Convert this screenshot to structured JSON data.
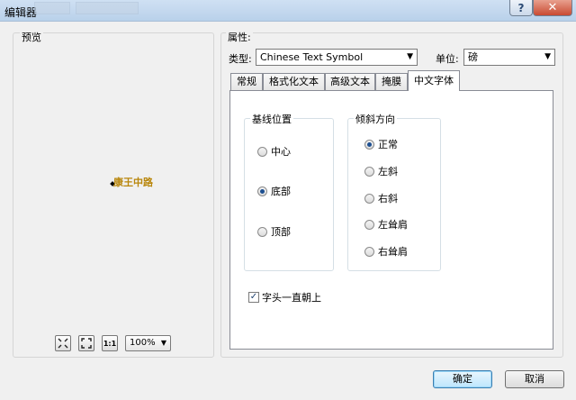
{
  "window": {
    "title": "编辑器",
    "help_label": "?",
    "close_label": "✕"
  },
  "preview": {
    "group_label": "预览",
    "sample_text": "康王中路",
    "zoom_value": "100%",
    "tool_icons": [
      "zoom-in-icon",
      "zoom-extent-icon",
      "actual-size-icon"
    ],
    "actual_size_label": "1:1"
  },
  "properties": {
    "group_label": "属性:",
    "type_label": "类型:",
    "type_value": "Chinese Text Symbol",
    "unit_label": "单位:",
    "unit_value": "磅"
  },
  "tabs": [
    {
      "label": "常规"
    },
    {
      "label": "格式化文本"
    },
    {
      "label": "高级文本"
    },
    {
      "label": "掩膜"
    },
    {
      "label": "中文字体"
    }
  ],
  "active_tab": "中文字体",
  "baseline": {
    "title": "基线位置",
    "options": [
      {
        "label": "中心",
        "checked": false
      },
      {
        "label": "底部",
        "checked": true
      },
      {
        "label": "顶部",
        "checked": false
      }
    ]
  },
  "slant": {
    "title": "倾斜方向",
    "options": [
      {
        "label": "正常",
        "checked": true
      },
      {
        "label": "左斜",
        "checked": false
      },
      {
        "label": "右斜",
        "checked": false
      },
      {
        "label": "左耸肩",
        "checked": false
      },
      {
        "label": "右耸肩",
        "checked": false
      }
    ]
  },
  "head_up": {
    "label": "字头一直朝上",
    "checked": true
  },
  "buttons": {
    "ok": "确定",
    "cancel": "取消"
  }
}
